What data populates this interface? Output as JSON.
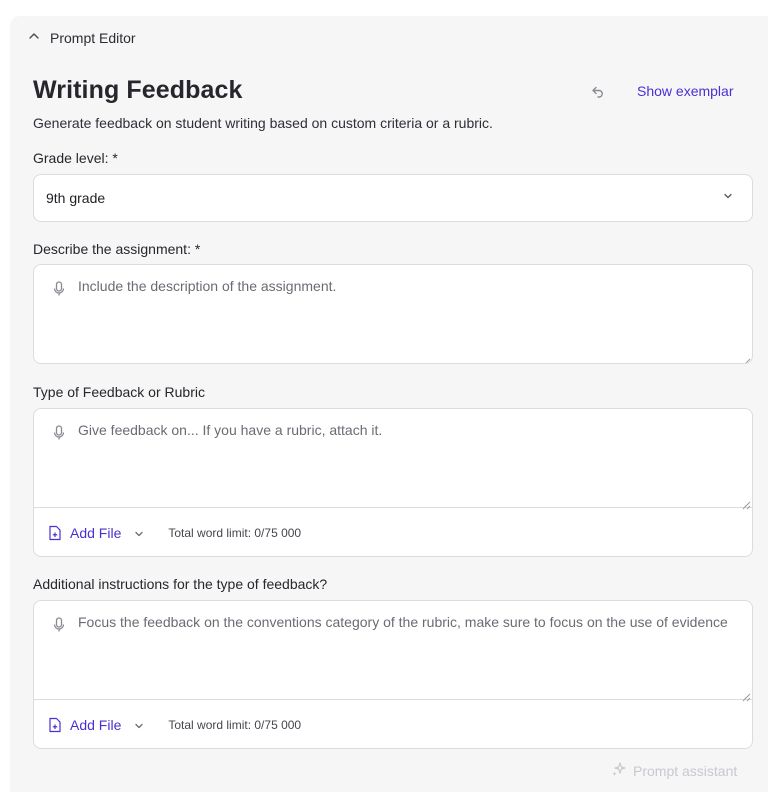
{
  "panel": {
    "title": "Prompt Editor"
  },
  "tool": {
    "title": "Writing Feedback",
    "subtitle": "Generate feedback on student writing based on custom criteria or a rubric.",
    "show_exemplar": "Show exemplar"
  },
  "fields": {
    "grade": {
      "label": "Grade level: *",
      "value": "9th grade"
    },
    "assignment": {
      "label": "Describe the assignment: *",
      "placeholder": "Include the description of the assignment."
    },
    "feedback_type": {
      "label": "Type of Feedback or Rubric",
      "placeholder": "Give feedback on... If you have a rubric, attach it.",
      "add_file": "Add File",
      "word_limit": "Total word limit: 0/75 000"
    },
    "additional": {
      "label": "Additional instructions for the type of feedback?",
      "placeholder": "Focus the feedback on the conventions category of the rubric, make sure to focus on the use of evidence",
      "add_file": "Add File",
      "word_limit": "Total word limit: 0/75 000"
    }
  },
  "footer": {
    "prompt_assistant": "Prompt assistant"
  },
  "colors": {
    "accent": "#4b2fd1",
    "panel_bg": "#f6f6f7",
    "border": "#dcdce0"
  },
  "icons": [
    "chevron-up-icon",
    "undo-icon",
    "chevron-down-icon",
    "microphone-icon",
    "file-add-icon",
    "sparkle-icon"
  ]
}
